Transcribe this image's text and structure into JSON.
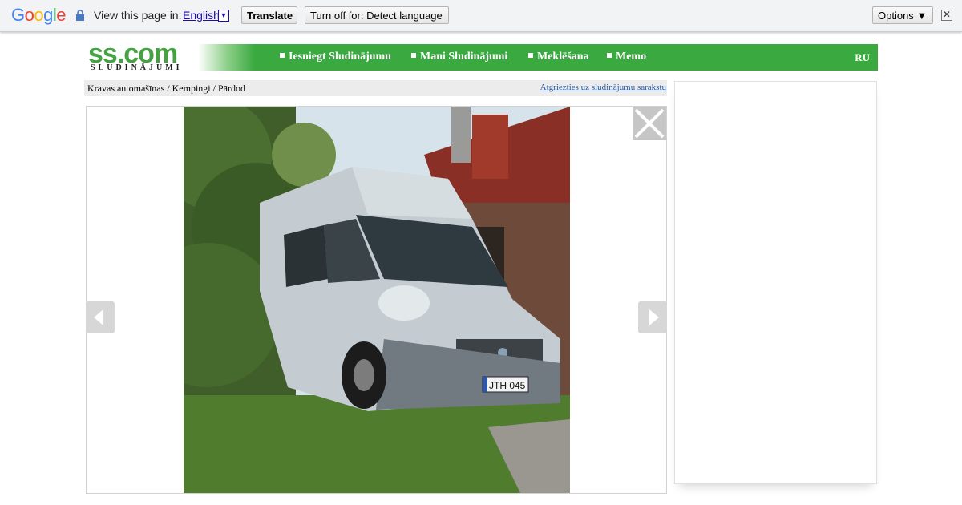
{
  "translate_bar": {
    "logo": "Google",
    "prompt": "View this page in:",
    "language": "English",
    "language_arrow": "▼",
    "translate_label": "Translate",
    "turn_off_label": "Turn off for: Detect language",
    "options_label": "Options ▼",
    "close_glyph": "✕"
  },
  "site": {
    "logo_main": "ss.com",
    "logo_sub": "SLUDINĀJUMI",
    "menu": [
      {
        "label": "Iesniegt Sludinājumu"
      },
      {
        "label": "Mani Sludinājumi"
      },
      {
        "label": "Meklēšana"
      },
      {
        "label": "Memo"
      }
    ],
    "lang_switch": "RU",
    "brand_green": "#39a940"
  },
  "breadcrumb": {
    "path": "Kravas automašīnas / Kempingi / Pārdod",
    "back_link": "Atgriezties uz sludinājumu sarakstu"
  },
  "gallery": {
    "photo_subject": "silver Fiat Ducato camper van parked on grass",
    "plate_text": "JTH 045",
    "prev_icon": "chevron-left-icon",
    "next_icon": "chevron-right-icon",
    "close_icon": "close-icon"
  }
}
